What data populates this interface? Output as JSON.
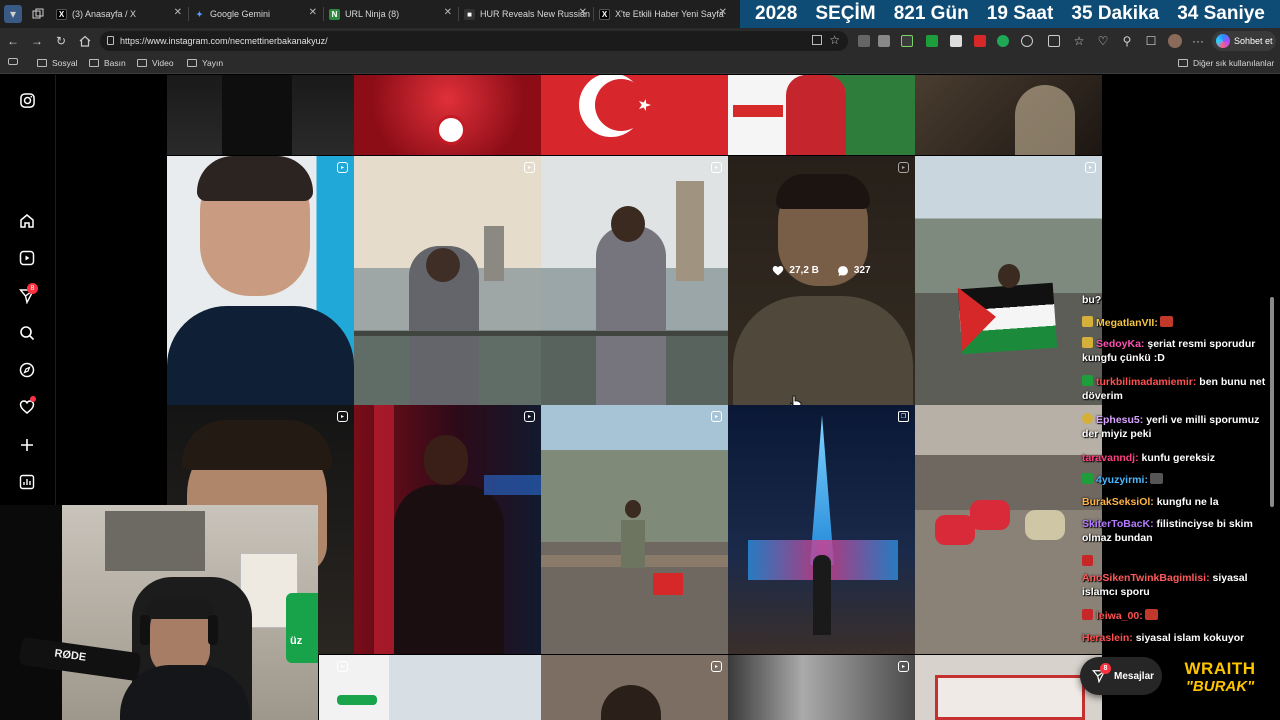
{
  "browser": {
    "tabs": [
      {
        "label": "(3) Anasayfa / X",
        "favicon": "x-icon"
      },
      {
        "label": "Google Gemini",
        "favicon": "gemini-icon"
      },
      {
        "label": "URL Ninja (8)",
        "favicon": "ninja-icon"
      },
      {
        "label": "HUR Reveals New Russian (",
        "favicon": "news-icon"
      },
      {
        "label": "X'te Etkili Haber Yeni Sayfa",
        "favicon": "x-icon"
      }
    ],
    "address": "https://www.instagram.com/necmettinerbakanakyuz/",
    "copilot_label": "Sohbet et",
    "bookmarks": [
      "Sosyal",
      "Basın",
      "Video",
      "Yayın"
    ],
    "other_bookmarks": "Diğer sık kullanılanlar"
  },
  "countdown": {
    "year": "2028",
    "label": "SEÇİM",
    "days": "821 Gün",
    "hours": "19 Saat",
    "minutes": "35 Dakika",
    "seconds": "34 Saniye"
  },
  "sidebar": {
    "notification_count": "8",
    "icons": [
      "instagram-icon",
      "home-icon",
      "reels-icon",
      "direct-icon",
      "search-icon",
      "explore-icon",
      "notifications-icon",
      "create-icon",
      "dashboard-icon"
    ]
  },
  "grid": {
    "hover_post": {
      "likes": "27,2 B",
      "comments": "327"
    },
    "partial_caption": "üz"
  },
  "chat": [
    {
      "user": "",
      "text": "bu?",
      "color": "#ffffff"
    },
    {
      "user": "MegatlanVII:",
      "text": "",
      "color": "#f5c542",
      "emote": true
    },
    {
      "user": "SedoyKa:",
      "text": "şeriat resmi sporudur kungfu çünkü :D",
      "color": "#ff4fb2"
    },
    {
      "user": "turkbilimadamiemir:",
      "text": "ben bunu net döverim",
      "color": "#ff5050"
    },
    {
      "user": "Ephesu5:",
      "text": "yerli ve milli sporumuz der miyiz peki",
      "color": "#d9a3ff"
    },
    {
      "user": "taravanndj:",
      "text": "kunfu gereksiz",
      "color": "#ff4080"
    },
    {
      "user": "4yuzyirmi:",
      "text": "",
      "color": "#4db8ff",
      "emote": true
    },
    {
      "user": "BurakSeksiOl:",
      "text": "kungfu ne la",
      "color": "#ffb347"
    },
    {
      "user": "SkiterToBacK:",
      "text": "filistinciyse bi skim olmaz bundan",
      "color": "#b57bff"
    },
    {
      "user": "",
      "text": "",
      "color": "#ff4040"
    },
    {
      "user": "AnoSikenTwinkBagimlisi:",
      "text": "siyasal islamcı sporu",
      "color": "#ff5a5a"
    },
    {
      "user": "leiwa_00:",
      "text": "",
      "color": "#ff5050",
      "emote": true
    },
    {
      "user": "Heraslein:",
      "text": "siyasal islam kokuyor",
      "color": "#ff5050"
    }
  ],
  "messages_button": {
    "label": "Mesajlar",
    "count": "8"
  },
  "stream_logo": {
    "line1": "WRAITH",
    "line2": "\"BURAK\""
  },
  "webcam": {
    "mic_brand": "RØDE"
  },
  "colors": {
    "countdown_bg": "#0f4c75",
    "instagram_badge": "#ff3040",
    "logo_yellow": "#ffc400"
  }
}
